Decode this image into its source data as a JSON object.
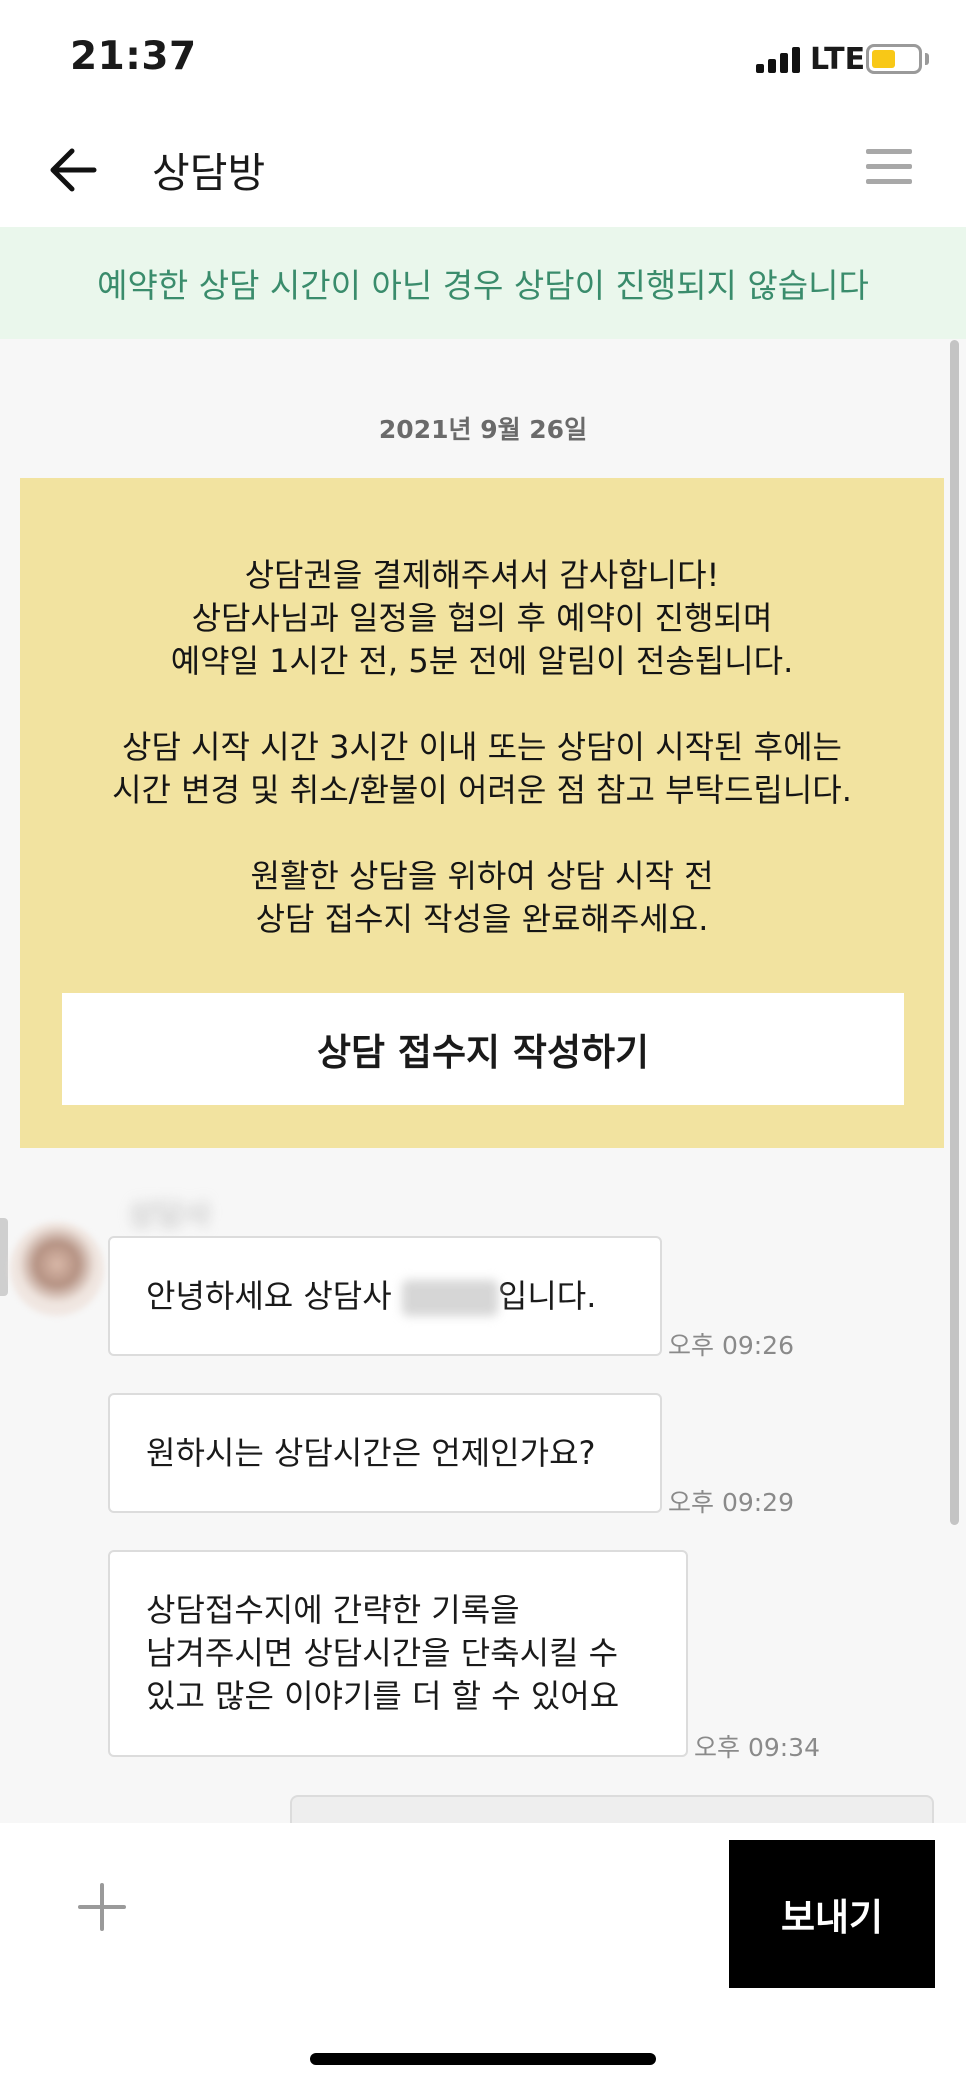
{
  "status_bar": {
    "time": "21:37",
    "network": "LTE",
    "battery_color": "#f8c817"
  },
  "nav": {
    "title": "상담방",
    "back_icon": "arrow-left-icon",
    "menu_icon": "hamburger-menu-icon"
  },
  "notice": {
    "text": "예약한 상담 시간이 아닌 경우 상담이 진행되지 않습니다",
    "text_color": "#3a8c6c",
    "background": "#eaf7ec"
  },
  "chat": {
    "date": "2021년 9월 26일",
    "info_card": {
      "background": "#f2e3a0",
      "lines": [
        "상담권을 결제해주셔서 감사합니다!",
        "상담사님과 일정을 협의 후 예약이 진행되며",
        "예약일 1시간 전, 5분 전에 알림이 전송됩니다.",
        "상담 시작 시간 3시간 이내 또는 상담이 시작된 후에는",
        "시간 변경 및 취소/환불이 어려운 점 참고 부탁드립니다.",
        "원활한 상담을 위하여 상담 시작 전",
        "상담 접수지 작성을 완료해주세요."
      ],
      "button_label": "상담 접수지 작성하기"
    },
    "messages": [
      {
        "text_before": "안녕하세요 상담사 ",
        "text_after": "입니다.",
        "time": "오후 09:26"
      },
      {
        "lines": [
          "원하시는 상담시간은 언제인가요?"
        ],
        "time": "오후 09:29"
      },
      {
        "lines": [
          "상담접수지에 간략한 기록을",
          "남겨주시면 상담시간을 단축시킬 수",
          "있고 많은 이야기를 더 할 수 있어요"
        ],
        "time": "오후 09:34"
      }
    ]
  },
  "composer": {
    "attach_icon": "plus-icon",
    "placeholder": "",
    "send_label": "보내기"
  }
}
